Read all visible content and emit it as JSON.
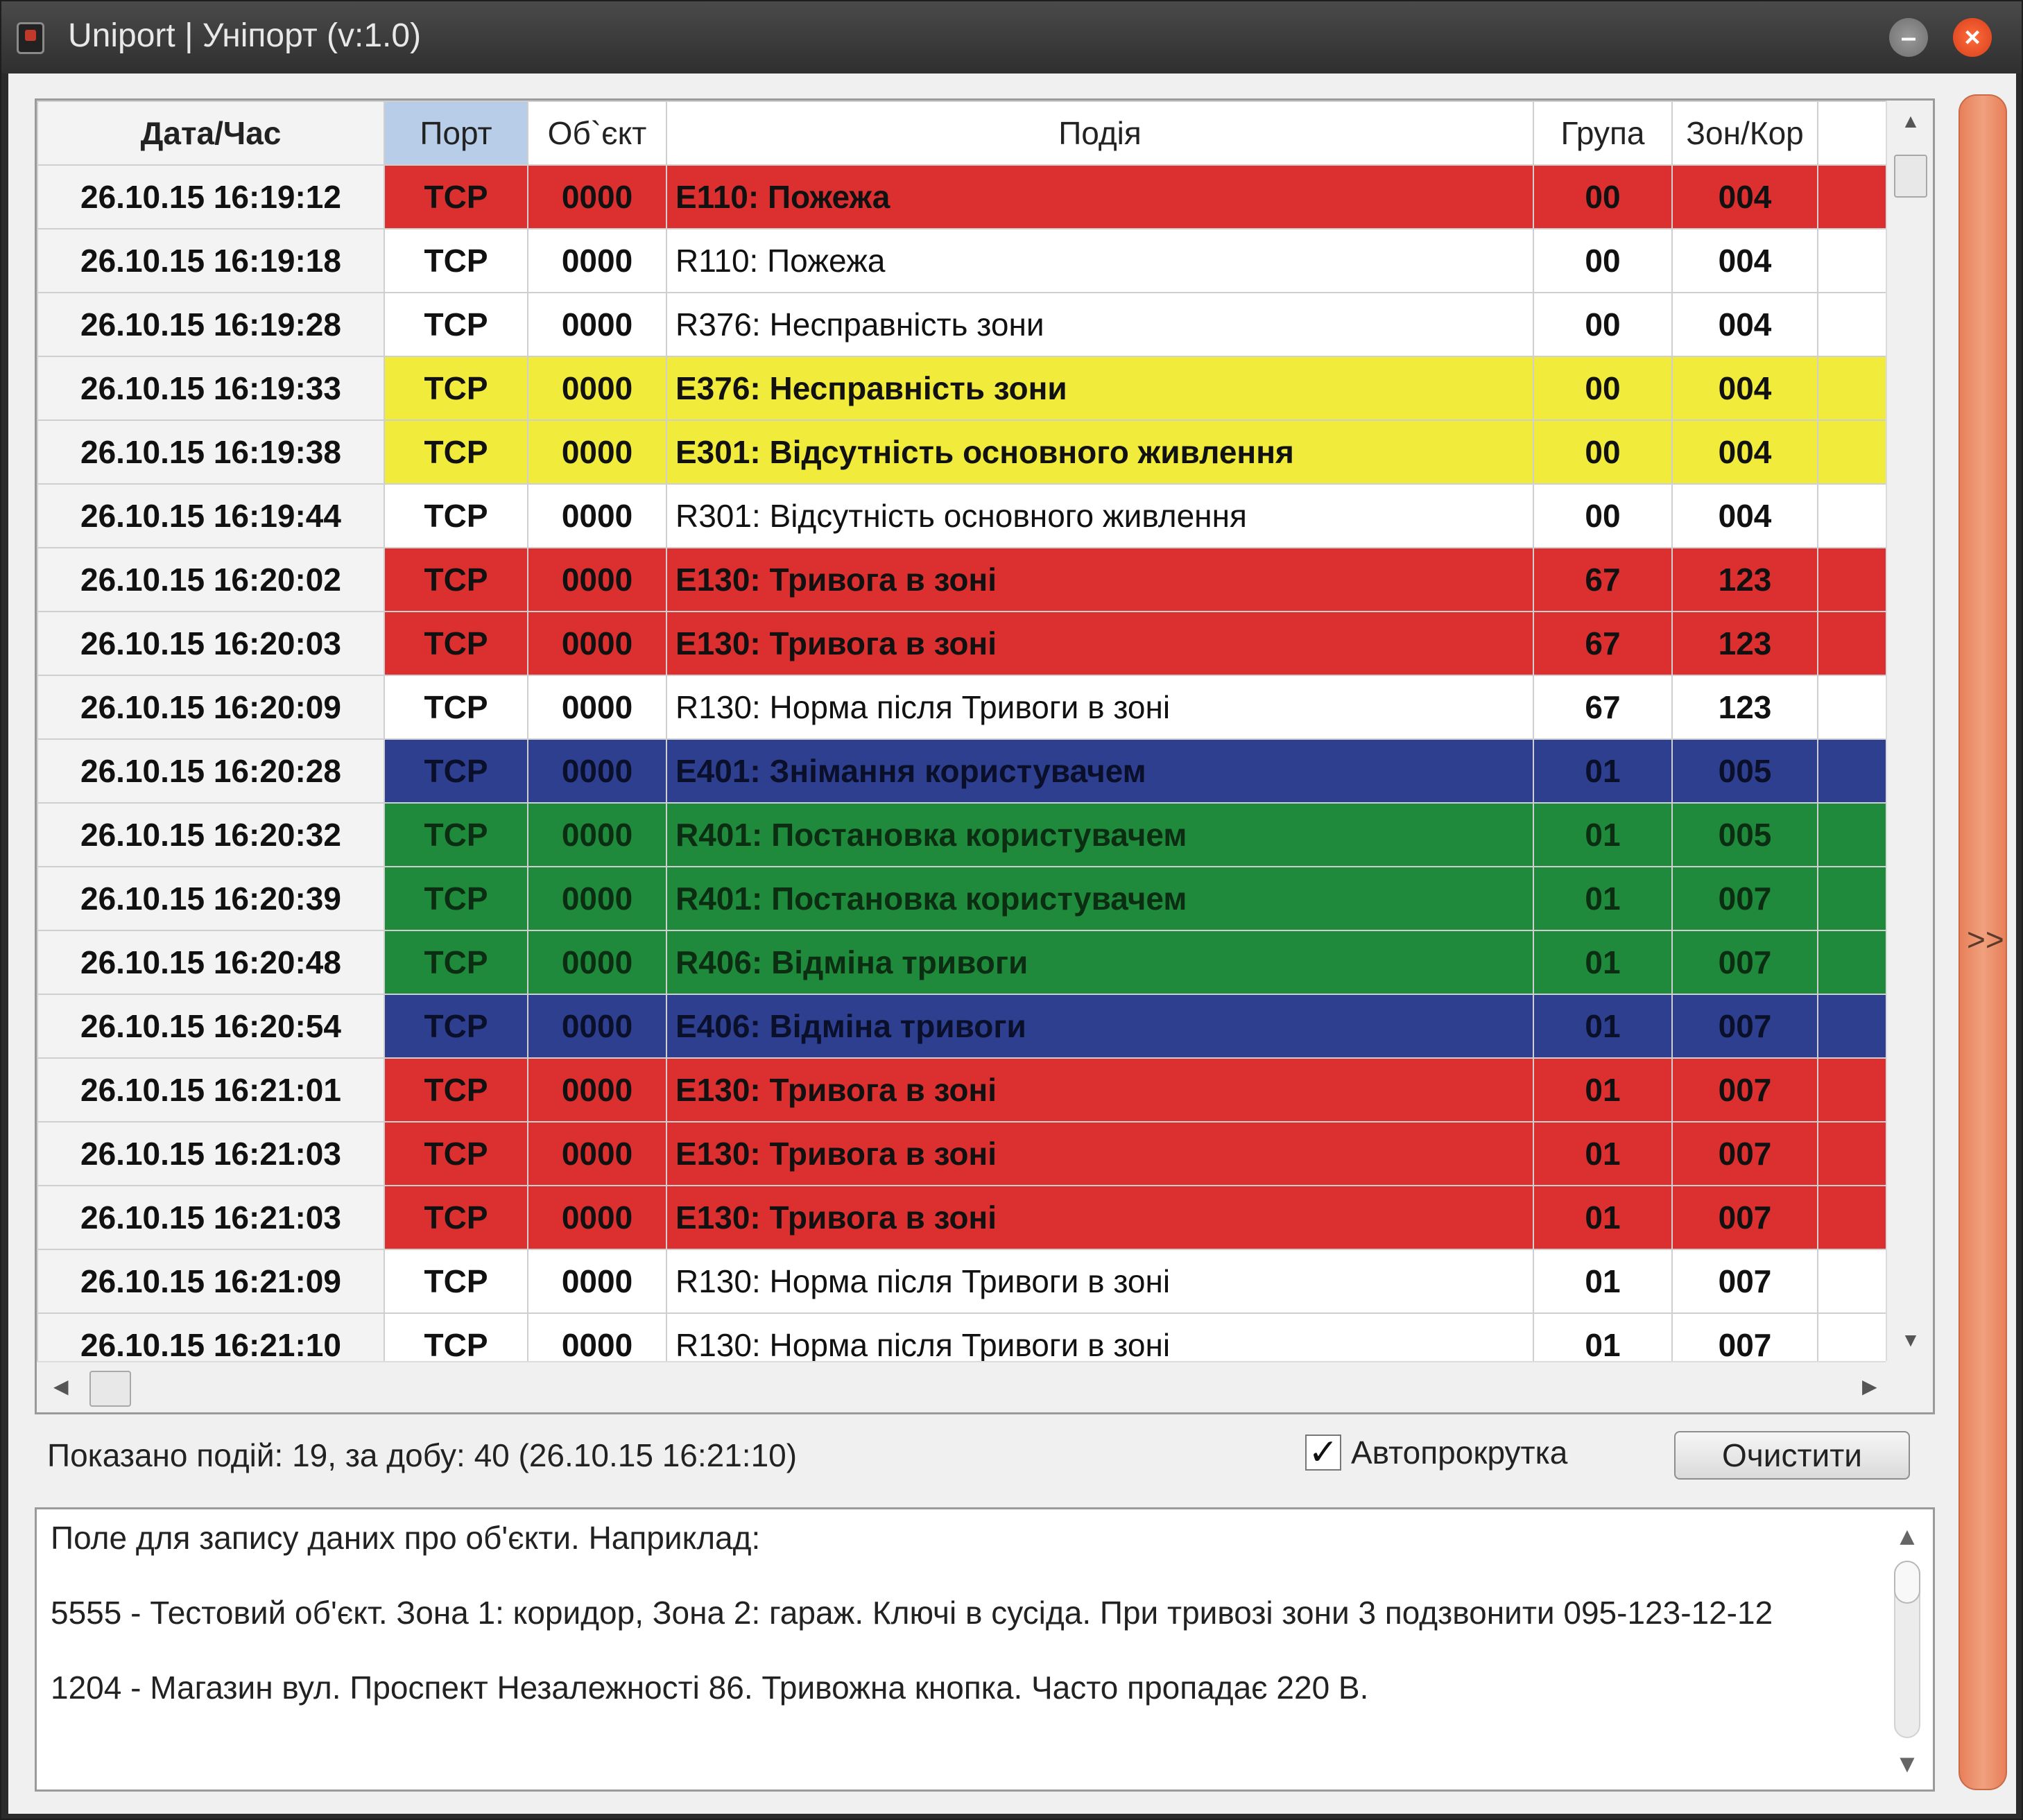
{
  "window": {
    "title": "Uniport | Уніпорт (v:1.0)",
    "minimize_icon": "minimize-icon",
    "close_icon": "close-icon"
  },
  "grid": {
    "columns": [
      "Дата/Час",
      "Порт",
      "Об`єкт",
      "Подія",
      "Група",
      "Зон/Кор"
    ],
    "rows": [
      {
        "datetime": "26.10.15 16:19:12",
        "port": "TCP",
        "object": "0000",
        "event": "E110: Пожежа",
        "group": "00",
        "zone": "004",
        "color": "red"
      },
      {
        "datetime": "26.10.15 16:19:18",
        "port": "TCP",
        "object": "0000",
        "event": "R110: Пожежа",
        "group": "00",
        "zone": "004",
        "color": "white"
      },
      {
        "datetime": "26.10.15 16:19:28",
        "port": "TCP",
        "object": "0000",
        "event": "R376: Несправність зони",
        "group": "00",
        "zone": "004",
        "color": "white"
      },
      {
        "datetime": "26.10.15 16:19:33",
        "port": "TCP",
        "object": "0000",
        "event": "E376: Несправність зони",
        "group": "00",
        "zone": "004",
        "color": "yellow"
      },
      {
        "datetime": "26.10.15 16:19:38",
        "port": "TCP",
        "object": "0000",
        "event": "E301: Відсутність основного живлення",
        "group": "00",
        "zone": "004",
        "color": "yellow"
      },
      {
        "datetime": "26.10.15 16:19:44",
        "port": "TCP",
        "object": "0000",
        "event": "R301: Відсутність основного живлення",
        "group": "00",
        "zone": "004",
        "color": "white"
      },
      {
        "datetime": "26.10.15 16:20:02",
        "port": "TCP",
        "object": "0000",
        "event": "E130: Тривога в зоні",
        "group": "67",
        "zone": "123",
        "color": "red"
      },
      {
        "datetime": "26.10.15 16:20:03",
        "port": "TCP",
        "object": "0000",
        "event": "E130: Тривога в зоні",
        "group": "67",
        "zone": "123",
        "color": "red"
      },
      {
        "datetime": "26.10.15 16:20:09",
        "port": "TCP",
        "object": "0000",
        "event": "R130: Норма після Тривоги в зоні",
        "group": "67",
        "zone": "123",
        "color": "white"
      },
      {
        "datetime": "26.10.15 16:20:28",
        "port": "TCP",
        "object": "0000",
        "event": "E401: Знімання користувачем",
        "group": "01",
        "zone": "005",
        "color": "blue"
      },
      {
        "datetime": "26.10.15 16:20:32",
        "port": "TCP",
        "object": "0000",
        "event": "R401: Постановка користувачем",
        "group": "01",
        "zone": "005",
        "color": "green"
      },
      {
        "datetime": "26.10.15 16:20:39",
        "port": "TCP",
        "object": "0000",
        "event": "R401: Постановка користувачем",
        "group": "01",
        "zone": "007",
        "color": "green"
      },
      {
        "datetime": "26.10.15 16:20:48",
        "port": "TCP",
        "object": "0000",
        "event": "R406: Відміна тривоги",
        "group": "01",
        "zone": "007",
        "color": "green"
      },
      {
        "datetime": "26.10.15 16:20:54",
        "port": "TCP",
        "object": "0000",
        "event": "E406: Відміна тривоги",
        "group": "01",
        "zone": "007",
        "color": "blue"
      },
      {
        "datetime": "26.10.15 16:21:01",
        "port": "TCP",
        "object": "0000",
        "event": "E130: Тривога в зоні",
        "group": "01",
        "zone": "007",
        "color": "red"
      },
      {
        "datetime": "26.10.15 16:21:03",
        "port": "TCP",
        "object": "0000",
        "event": "E130: Тривога в зоні",
        "group": "01",
        "zone": "007",
        "color": "red"
      },
      {
        "datetime": "26.10.15 16:21:03",
        "port": "TCP",
        "object": "0000",
        "event": "E130: Тривога в зоні",
        "group": "01",
        "zone": "007",
        "color": "red"
      },
      {
        "datetime": "26.10.15 16:21:09",
        "port": "TCP",
        "object": "0000",
        "event": "R130: Норма після Тривоги в зоні",
        "group": "01",
        "zone": "007",
        "color": "white"
      },
      {
        "datetime": "26.10.15 16:21:10",
        "port": "TCP",
        "object": "0000",
        "event": "R130: Норма після Тривоги в зоні",
        "group": "01",
        "zone": "007",
        "color": "white"
      }
    ]
  },
  "status": {
    "text": "Показано подій: 19, за добу: 40 (26.10.15 16:21:10)",
    "autoscroll_label": "Автопрокрутка",
    "autoscroll_checked": true,
    "clear_button": "Очистити"
  },
  "notes": {
    "lines": [
      "Поле для запису даних про об'єкти. Наприклад:",
      "5555 - Тестовий об'єкт. Зона 1: коридор, Зона 2: гараж. Ключі в сусіда. При тривозі зони 3 подзвонити 095-123-12-12",
      "1204 - Магазин вул. Проспект Незалежності 86. Тривожна кнопка. Часто пропадає 220 В."
    ]
  },
  "side_panel": {
    "toggle_label": ">>"
  },
  "colors": {
    "red": "#dc2f2f",
    "yellow": "#f1ec3c",
    "blue": "#2e3f8f",
    "green": "#1f8a3c",
    "header_selected": "#b8cde8",
    "side_panel": "#f0a07e"
  }
}
